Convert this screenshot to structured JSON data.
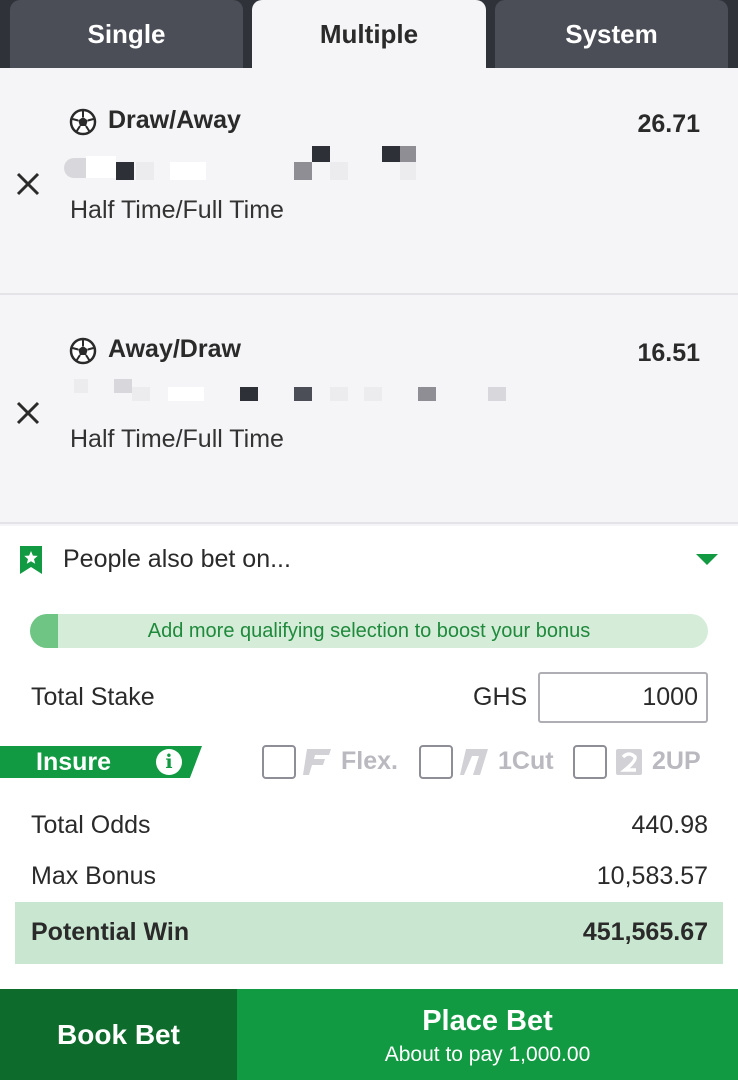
{
  "tabs": [
    {
      "label": "Single",
      "active": false
    },
    {
      "label": "Multiple",
      "active": true
    },
    {
      "label": "System",
      "active": false
    }
  ],
  "selections": [
    {
      "icon": "soccer-ball-icon",
      "pick": "Draw/Away",
      "odds": "26.71",
      "market": "Half Time/Full Time"
    },
    {
      "icon": "soccer-ball-icon",
      "pick": "Away/Draw",
      "odds": "16.51",
      "market": "Half Time/Full Time"
    }
  ],
  "people_also_bet": {
    "label": "People also bet on...",
    "icon": "bookmark-star-icon"
  },
  "bonus_banner": "Add more qualifying selection to boost your bonus",
  "stake": {
    "label": "Total Stake",
    "currency": "GHS",
    "value": "1000"
  },
  "insure": {
    "label": "Insure",
    "icon": "info-icon"
  },
  "options": [
    {
      "label": "Flex.",
      "checked": false
    },
    {
      "label": "1Cut",
      "checked": false
    },
    {
      "label": "2UP",
      "checked": false
    }
  ],
  "summary": {
    "total_odds_label": "Total Odds",
    "total_odds_value": "440.98",
    "max_bonus_label": "Max Bonus",
    "max_bonus_value": "10,583.57",
    "potential_win_label": "Potential Win",
    "potential_win_value": "451,565.67"
  },
  "actions": {
    "book_label": "Book Bet",
    "place_label": "Place Bet",
    "place_sub": "About to pay 1,000.00"
  },
  "colors": {
    "accent_green": "#129a43",
    "dark_green": "#0d6b2b",
    "tab_bar": "#2f3239",
    "potential_bg": "#c9e7d0"
  }
}
